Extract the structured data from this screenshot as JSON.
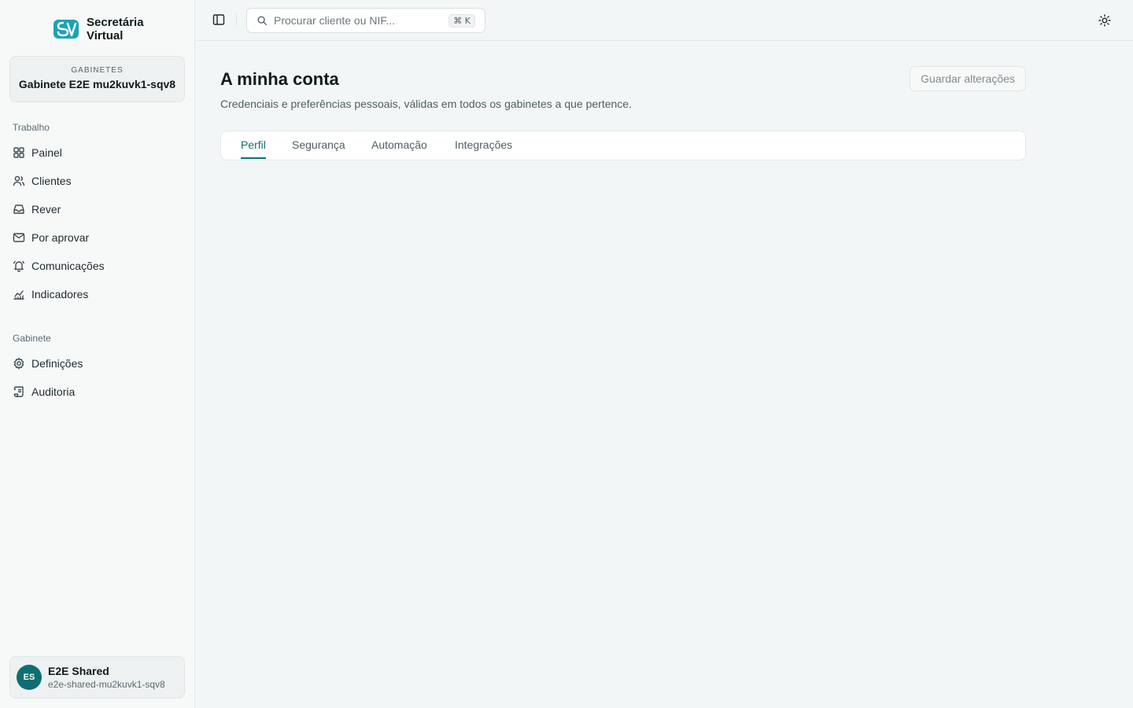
{
  "brand": {
    "line1": "Secretária",
    "line2": "Virtual"
  },
  "workspace": {
    "label": "GABINETES",
    "name": "Gabinete E2E mu2kuvk1-sqv8"
  },
  "sections": {
    "work": "Trabalho",
    "office": "Gabinete"
  },
  "nav": {
    "painel": "Painel",
    "clientes": "Clientes",
    "rever": "Rever",
    "por_aprovar": "Por aprovar",
    "comunicacoes": "Comunicações",
    "indicadores": "Indicadores",
    "definicoes": "Definições",
    "auditoria": "Auditoria"
  },
  "user": {
    "initials": "ES",
    "name": "E2E Shared",
    "email": "e2e-shared-mu2kuvk1-sqv8"
  },
  "search": {
    "placeholder": "Procurar cliente ou NIF...",
    "shortcut": "⌘ K"
  },
  "page": {
    "title": "A minha conta",
    "subtitle": "Credenciais e preferências pessoais, válidas em todos os gabinetes a que pertence.",
    "save_label": "Guardar alterações"
  },
  "tabs": {
    "perfil": "Perfil",
    "seguranca": "Segurança",
    "automacao": "Automação",
    "integracoes": "Integrações"
  },
  "colors": {
    "accent": "#0d6f73",
    "brand": "#1aa3b8"
  }
}
